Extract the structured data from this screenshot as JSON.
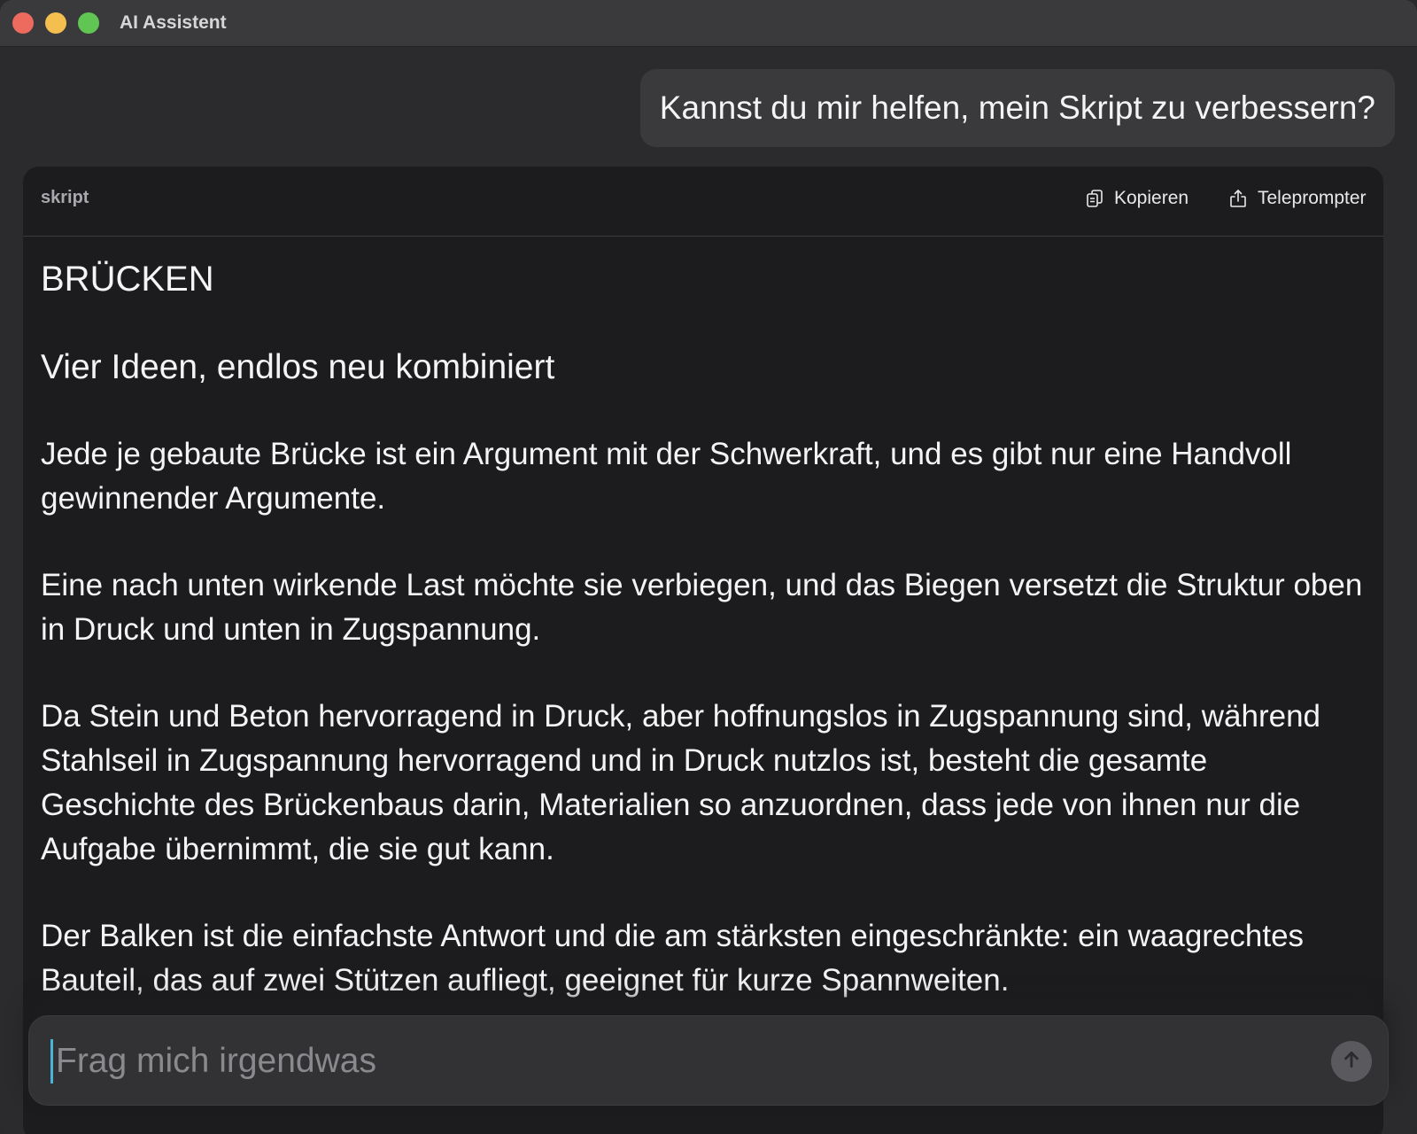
{
  "window": {
    "title": "AI Assistent"
  },
  "chat": {
    "user_message": "Kannst du mir helfen, mein Skript zu verbessern?"
  },
  "card": {
    "label": "skript",
    "actions": {
      "copy_label": "Kopieren",
      "copy_icon": "copy-icon",
      "teleprompter_label": "Teleprompter",
      "teleprompter_icon": "share-icon"
    },
    "title": "BRÜCKEN",
    "subtitle": "Vier Ideen, endlos neu kombiniert",
    "paragraphs": [
      "Jede je gebaute Brücke ist ein Argument mit der Schwerkraft, und es gibt nur eine Handvoll gewinnender Argumente.",
      "Eine nach unten wirkende Last möchte sie verbiegen, und das Biegen versetzt die Struktur oben in Druck und unten in Zugspannung.",
      "Da Stein und Beton hervorragend in Druck, aber hoffnungslos in Zugspannung sind, während Stahlseil in Zugspannung hervorragend und in Druck nutzlos ist, besteht die gesamte Geschichte des Brückenbaus darin, Materialien so anzuordnen, dass jede von ihnen nur die Aufgabe übernimmt, die sie gut kann.",
      "Der Balken ist die einfachste Antwort und die am stärksten eingeschränkte: ein waagrechtes Bauteil, das auf zwei Stützen aufliegt, geeignet für kurze Spannweiten."
    ]
  },
  "composer": {
    "placeholder": "Frag mich irgendwas",
    "value": "",
    "send_icon": "arrow-up-icon"
  },
  "colors": {
    "window_bg": "#2b2b2d",
    "card_bg": "#1c1c1e",
    "bubble_bg": "#3a3a3c",
    "caret": "#4ab4d8",
    "traffic_red": "#ed6a5e",
    "traffic_yellow": "#f5bf4f",
    "traffic_green": "#61c554"
  }
}
